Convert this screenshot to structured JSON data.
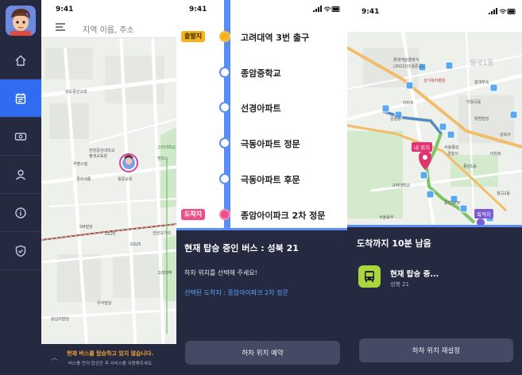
{
  "left_screen": {
    "time": "9:41",
    "search_placeholder": "지역 이름, 주소",
    "map_labels": {
      "l1": "상도중앙교회",
      "l2": "한양중앙대학교",
      "l3": "평생교육원",
      "l4": "루벤스빌",
      "l5": "용문교회",
      "l6": "고려대학교",
      "l7": "캠퍼스",
      "l8": "경희세종",
      "l9": "5M빌딩",
      "l10": "안암오거리",
      "l11": "GS25",
      "l12": "GS25",
      "l13": "우석빌딩",
      "l14": "왕십리빌딩",
      "l15": "고려대역"
    },
    "notice_title": "현재 버스를 탑승하고 있지 않습니다.",
    "notice_sub": "버스를 먼저 탑승한 후 서비스를 이용해주세요."
  },
  "middle_screen": {
    "time": "9:41",
    "start_tag": "출발지",
    "end_tag": "도착지",
    "stops": [
      "고려대역 3번 출구",
      "종암중학교",
      "선경아파트",
      "극동아파트 정문",
      "극동아파트 후문",
      "종암아이파크 2차 정문"
    ],
    "panel_title": "현재 탑승 중인 버스 : 성북 21",
    "panel_guide": "하차 위치를 선택해 주세요!",
    "panel_dest": "선택된 도착지 : 종암아이파크 2차 정문",
    "button": "하차 위치 예약"
  },
  "right_screen": {
    "time": "9:41",
    "map_labels": {
      "r1": "롯데캐슬클래식",
      "r2": "(2022년1월준공)",
      "r3": "월곡1동",
      "r4": "성가복지병원",
      "r5": "홍대부속",
      "r6": "하월곡동",
      "r7": "아파트",
      "r8": "길음동",
      "r9": "서울종암",
      "r10": "경찰서",
      "r11": "창범빌딩",
      "r12": "아파트",
      "r13": "고려대학교",
      "r14": "종암SK뷰",
      "r15": "서울동부",
      "r16": "종암1동",
      "r17": "월곡2동",
      "r18": "성북구"
    },
    "my_location": "내 위치",
    "destination": "목적지",
    "panel_title": "도착까지 10분 남음",
    "bus_name": "현재 탑승 중...",
    "bus_route": "성북 21",
    "button": "하차 위치 재설정"
  },
  "colors": {
    "navy": "#262a40",
    "accent_blue": "#2f6cf0",
    "route_blue": "#5a8cf5",
    "start_yellow": "#f5b21c",
    "end_pink": "#f04e8a",
    "bus_green": "#a9d63b"
  }
}
